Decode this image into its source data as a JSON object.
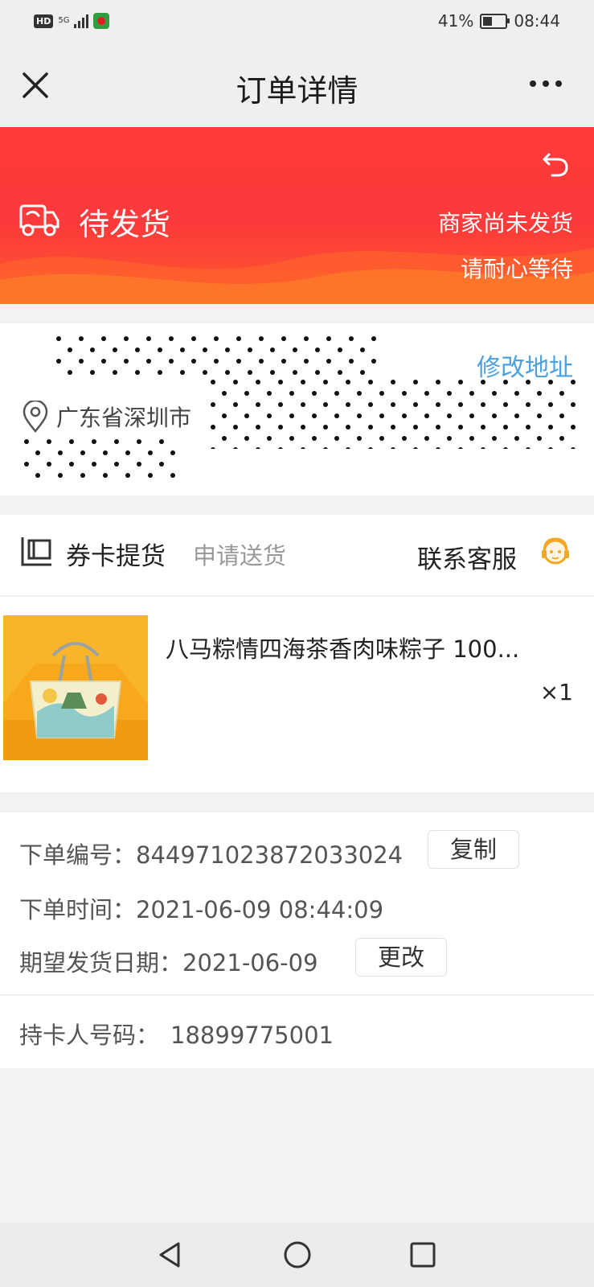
{
  "status_bar": {
    "hd": "HD",
    "network": "5G",
    "battery": "41%",
    "time": "08:44"
  },
  "nav": {
    "title": "订单详情"
  },
  "banner": {
    "status": "待发货",
    "message_line1": "商家尚未发货",
    "message_line2": "请耐心等待",
    "color_top": "#ff3a3a",
    "color_bottom": "#ff5a2c"
  },
  "address": {
    "modify_label": "修改地址",
    "text": "广东省深圳市",
    "link_color": "#4aa0e2"
  },
  "order": {
    "voucher_label": "券卡提货",
    "apply_delivery_label": "申请送货",
    "contact_label": "联系客服",
    "product_name": "八马粽情四海茶香肉味粽子 100...",
    "quantity": "×1"
  },
  "info": {
    "order_no_label": "下单编号：",
    "order_no": "844971023872033024",
    "copy_label": "复制",
    "order_time_label": "下单时间：",
    "order_time": "2021-06-09 08:44:09",
    "ship_date_label": "期望发货日期：",
    "ship_date": "2021-06-09",
    "change_label": "更改",
    "holder_phone_label": "持卡人号码：",
    "holder_phone": "18899775001"
  },
  "icons": {
    "close": "close-icon",
    "more": "more-icon",
    "truck": "truck-icon",
    "back": "undo-icon",
    "pin": "location-pin-icon",
    "voucher": "voucher-icon",
    "cs": "customer-service-icon"
  }
}
